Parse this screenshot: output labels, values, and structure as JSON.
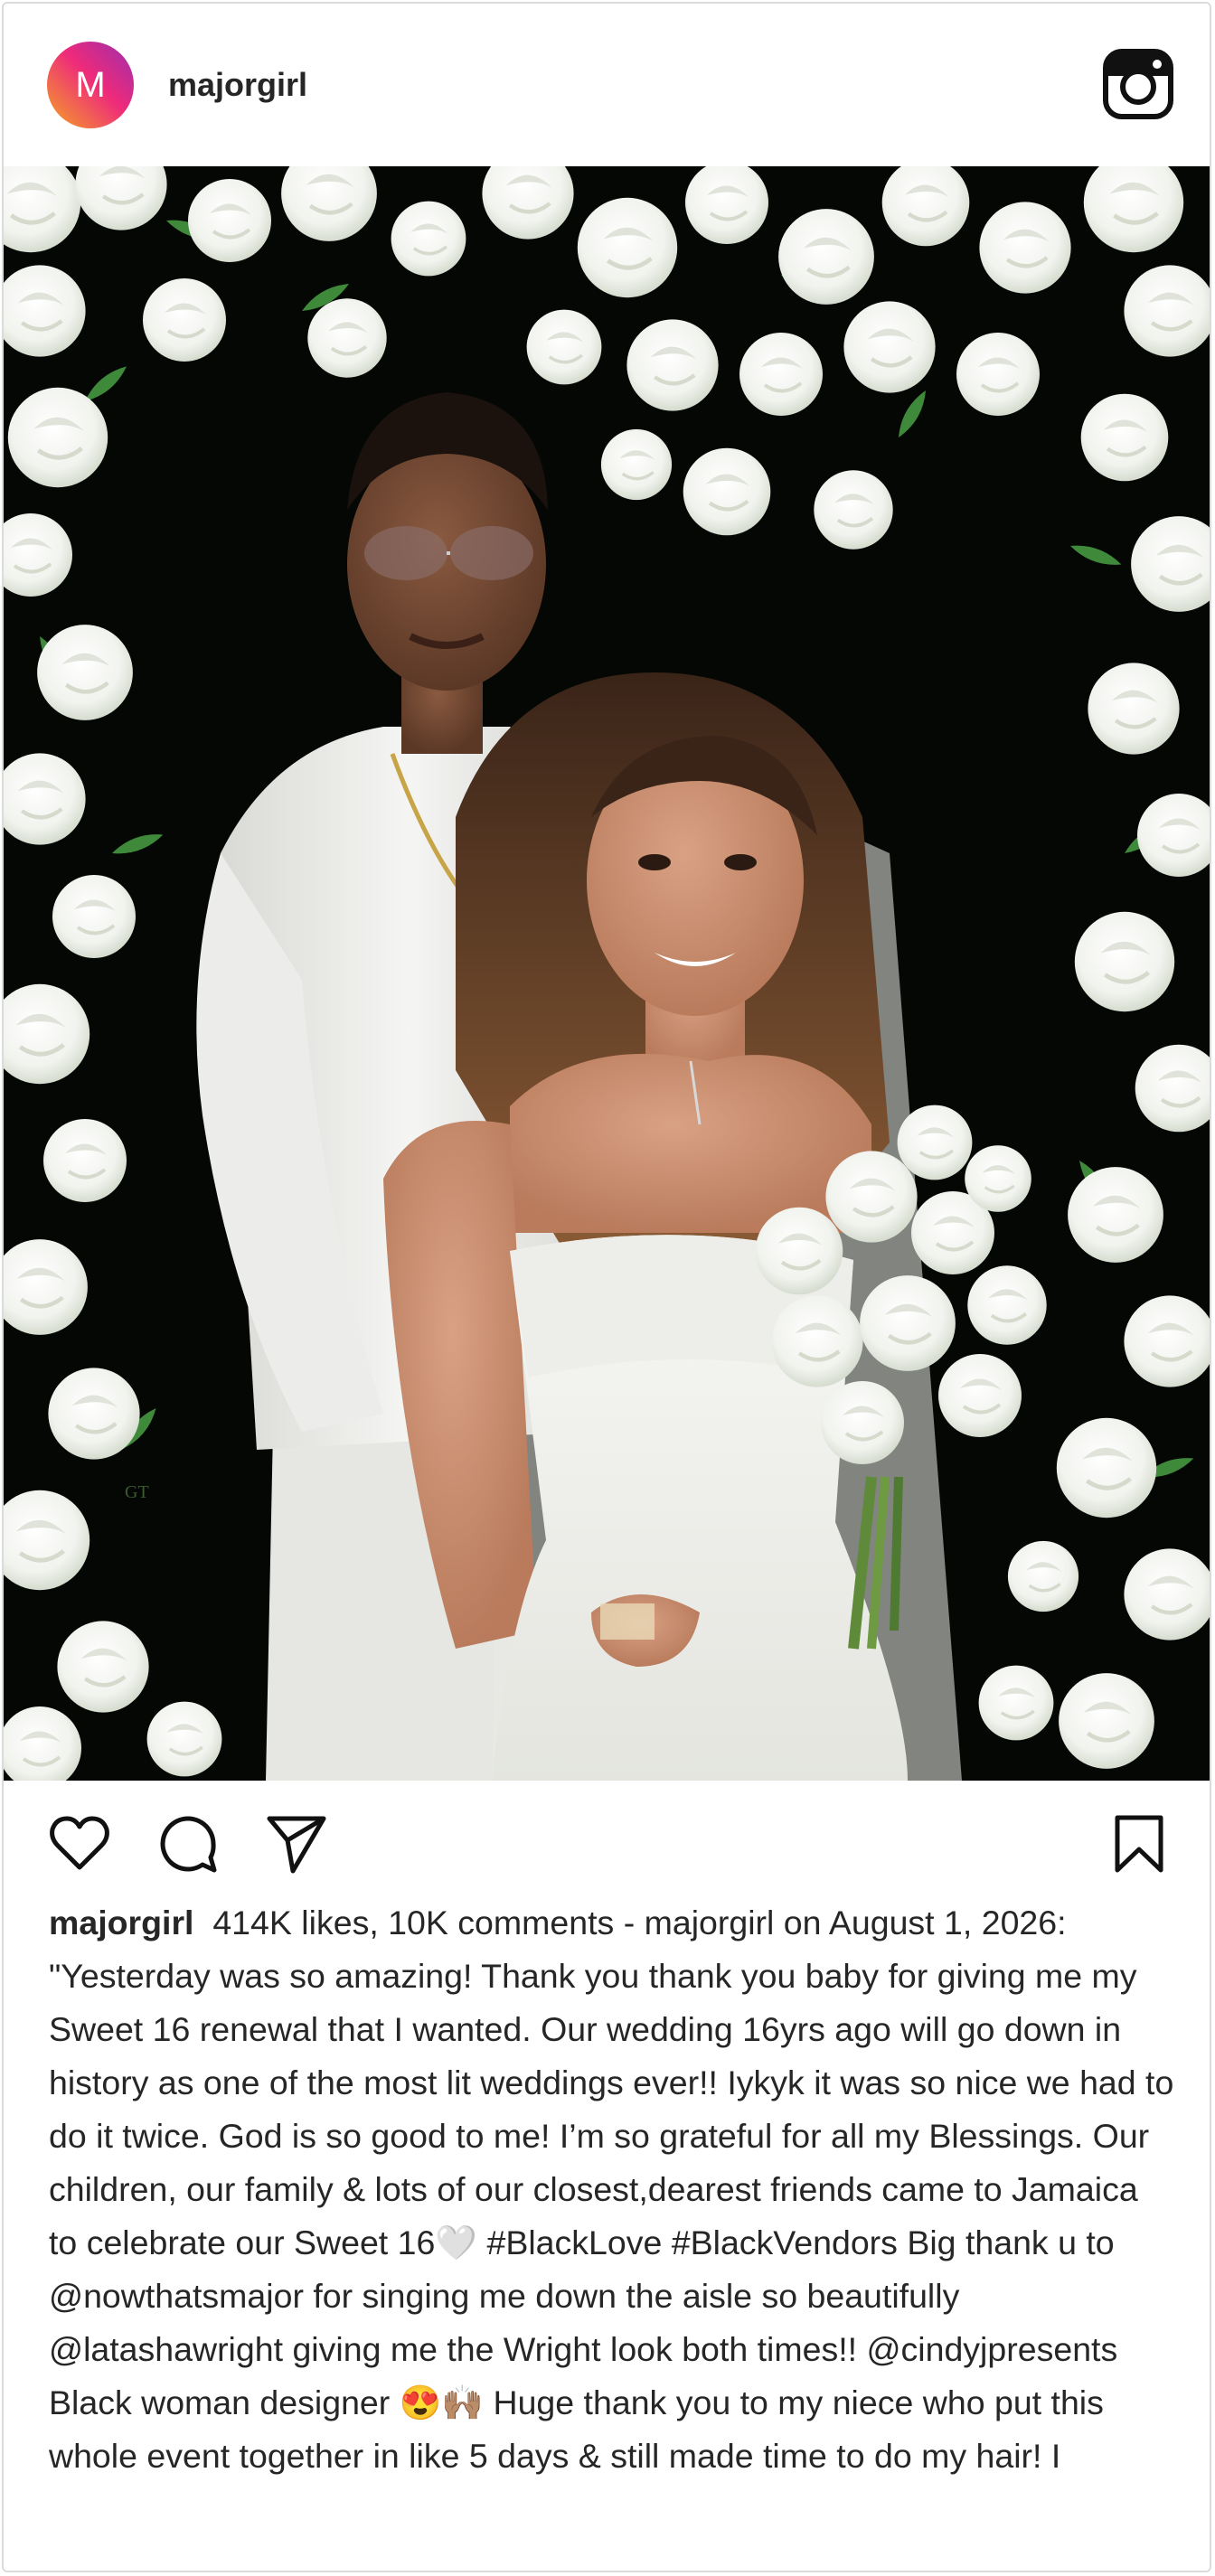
{
  "app": "Instagram",
  "post": {
    "avatar_letter": "M",
    "username": "majorgirl",
    "photo_alt": "",
    "caption_username": "majorgirl",
    "caption_text": "414K likes, 10K comments - majorgirl on August 1, 2026: \"Yesterday was so amazing! Thank you thank you baby for giving me my Sweet 16 renewal that I wanted. Our wedding 16yrs ago will go down in history as one of the most lit weddings ever!! Iykyk it was so nice we had to do it twice. God is so good to me! I’m so grateful for all my Blessings. Our children, our family & lots of our closest,dearest friends came to Jamaica to celebrate our Sweet 16🤍 #BlackLove #BlackVendors Big thank u to @nowthatsmajor for singing me down the aisle so beautifully @latashawright giving me the Wright look both times!! @cindyjpresents Black woman designer 😍🙌🏽 Huge thank you to my niece who put this whole event together in like 5 days & still made time to do my hair! I",
    "photo_watermark": "GT"
  },
  "icons": {
    "header_right": "instagram-logo-icon",
    "like": "heart-icon",
    "comment": "comment-bubble-icon",
    "share": "send-paper-plane-icon",
    "save": "bookmark-icon"
  },
  "colors": {
    "avatar_gradient_start": "#f5a623",
    "avatar_gradient_mid": "#ee2a7b",
    "avatar_gradient_end": "#9b2fae",
    "text": "#262626",
    "border": "#dbdbdb"
  }
}
